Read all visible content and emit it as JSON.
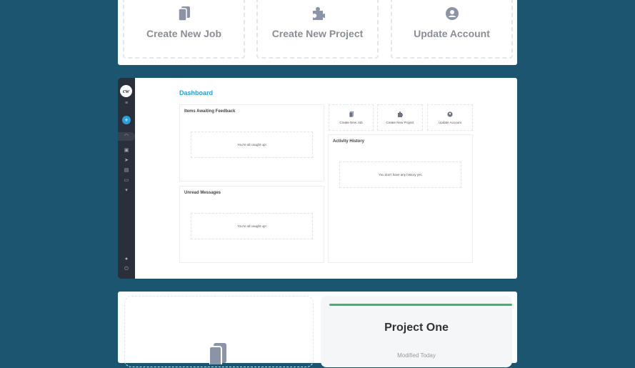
{
  "top_tiles": [
    {
      "label": "Create New Job",
      "icon": "copy-icon"
    },
    {
      "label": "Create New Project",
      "icon": "puzzle-icon"
    },
    {
      "label": "Update Account",
      "icon": "user-circle-icon"
    }
  ],
  "app": {
    "logo": "cw",
    "title": "Dashboard"
  },
  "panels": {
    "feedback": {
      "title": "Items Awaiting Feedback",
      "empty": "You're all caught up!"
    },
    "messages": {
      "title": "Unread Messages",
      "empty": "You're all caught up!"
    },
    "history": {
      "title": "Activity History",
      "empty": "You don't have any history yet."
    }
  },
  "small_tiles": [
    {
      "label": "Create New Job"
    },
    {
      "label": "Create New Project"
    },
    {
      "label": "Update Account"
    }
  ],
  "project": {
    "title": "Project One",
    "modified": "Modified Today",
    "accent": "#3cb371"
  }
}
